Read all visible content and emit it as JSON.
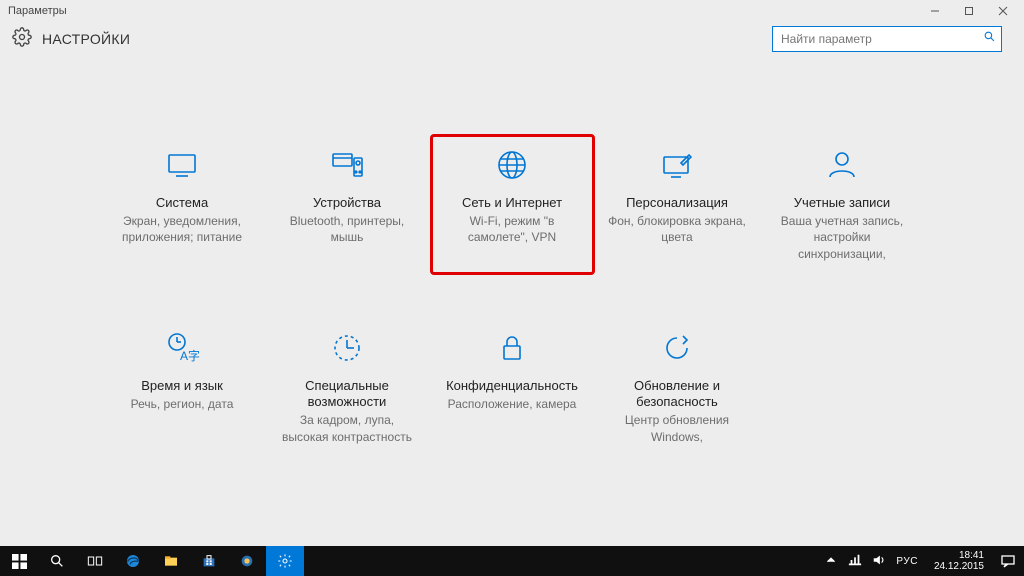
{
  "window": {
    "title": "Параметры"
  },
  "header": {
    "heading": "НАСТРОЙКИ"
  },
  "search": {
    "placeholder": "Найти параметр"
  },
  "tiles": {
    "system": {
      "title": "Система",
      "desc": "Экран, уведомления, приложения; питание"
    },
    "devices": {
      "title": "Устройства",
      "desc": "Bluetooth, принтеры, мышь"
    },
    "network": {
      "title": "Сеть и Интернет",
      "desc": "Wi-Fi, режим \"в самолете\", VPN"
    },
    "personalization": {
      "title": "Персонализация",
      "desc": "Фон, блокировка экрана, цвета"
    },
    "accounts": {
      "title": "Учетные записи",
      "desc": "Ваша учетная запись, настройки синхронизации,"
    },
    "timelang": {
      "title": "Время и язык",
      "desc": "Речь, регион, дата"
    },
    "ease": {
      "title": "Специальные возможности",
      "desc": "За кадром, лупа, высокая контрастность"
    },
    "privacy": {
      "title": "Конфиденциальность",
      "desc": "Расположение, камера"
    },
    "update": {
      "title": "Обновление и безопасность",
      "desc": "Центр обновления Windows,"
    }
  },
  "tray": {
    "lang": "РУС",
    "time": "18:41",
    "date": "24.12.2015"
  }
}
